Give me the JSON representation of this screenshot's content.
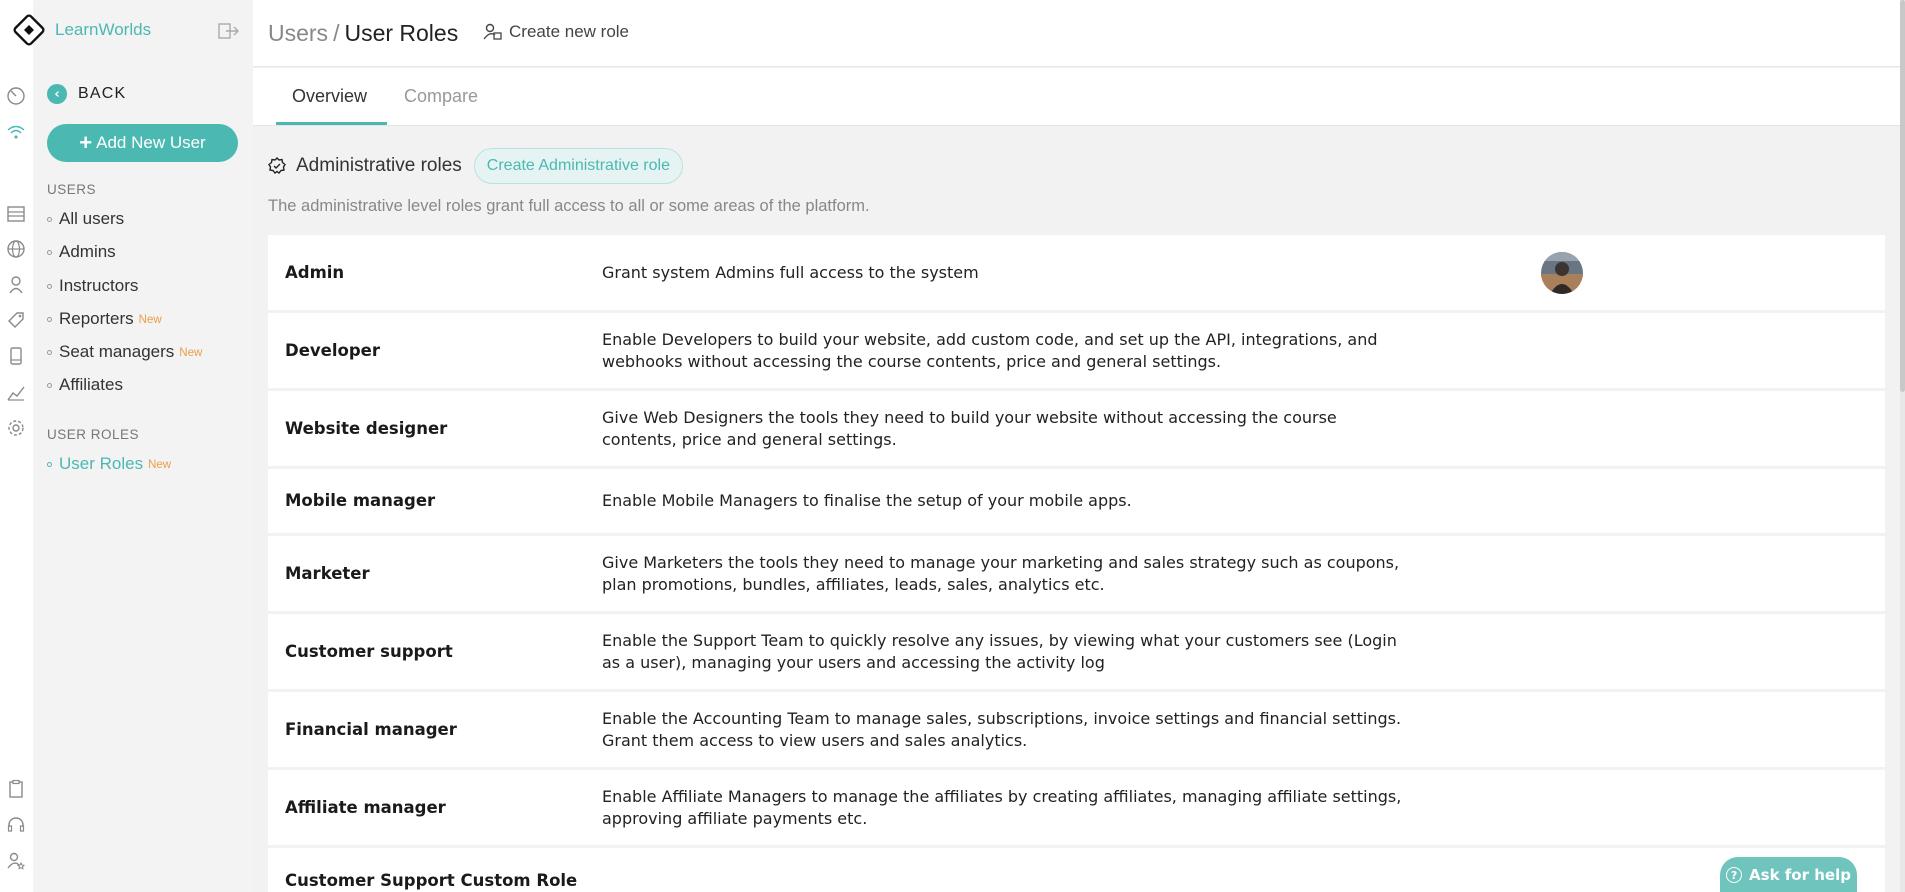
{
  "brand": {
    "name": "LearnWorlds"
  },
  "sidebar": {
    "back_label": "BACK",
    "add_user_label": "Add New User",
    "users_heading": "USERS",
    "user_items": [
      {
        "label": "All users",
        "badge": ""
      },
      {
        "label": "Admins",
        "badge": ""
      },
      {
        "label": "Instructors",
        "badge": ""
      },
      {
        "label": "Reporters",
        "badge": "New"
      },
      {
        "label": "Seat managers",
        "badge": "New"
      },
      {
        "label": "Affiliates",
        "badge": ""
      }
    ],
    "roles_heading": "USER ROLES",
    "role_items": [
      {
        "label": "User Roles",
        "badge": "New"
      }
    ]
  },
  "header": {
    "crumb_parent": "Users",
    "crumb_sep": "/",
    "crumb_current": "User Roles",
    "create_role_label": "Create new role"
  },
  "tabs": [
    {
      "label": "Overview",
      "active": true
    },
    {
      "label": "Compare",
      "active": false
    }
  ],
  "section": {
    "title": "Administrative roles",
    "create_button": "Create Administrative role",
    "description": "The administrative level roles grant full access to all or some areas of the platform."
  },
  "roles": [
    {
      "name": "Admin",
      "description": "Grant system Admins full access to the system",
      "has_avatar": true
    },
    {
      "name": "Developer",
      "description": "Enable Developers to build your website, add custom code, and set up the API, integrations, and webhooks without accessing the course contents, price and general settings."
    },
    {
      "name": "Website designer",
      "description": "Give Web Designers the tools they need to build your website without accessing the course contents, price and general settings."
    },
    {
      "name": "Mobile manager",
      "description": "Enable Mobile Managers to finalise the setup of your mobile apps."
    },
    {
      "name": "Marketer",
      "description": "Give Marketers the tools they need to manage your marketing and sales strategy such as coupons, plan promotions, bundles, affiliates, leads, sales, analytics etc."
    },
    {
      "name": "Customer support",
      "description": "Enable the Support Team to quickly resolve any issues, by viewing what your customers see (Login as a user), managing your users and accessing the activity log"
    },
    {
      "name": "Financial manager",
      "description": "Enable the Accounting Team to manage sales, subscriptions, invoice settings and financial settings. Grant them access to view users and sales analytics."
    },
    {
      "name": "Affiliate manager",
      "description": "Enable Affiliate Managers to manage the affiliates by creating affiliates, managing affiliate settings, approving affiliate payments etc."
    },
    {
      "name": "Customer Support Custom Role",
      "description": ""
    }
  ],
  "help": {
    "label": "Ask for help"
  },
  "colors": {
    "accent": "#4cb8b2",
    "new_badge": "#e8a046"
  },
  "icons": {
    "rail_top": [
      "dashboard-icon",
      "wifi-icon"
    ],
    "rail_mid": [
      "list-icon",
      "globe-icon",
      "user-icon",
      "tag-icon",
      "mobile-icon",
      "chart-icon",
      "gear-icon"
    ],
    "rail_bottom": [
      "clipboard-icon",
      "headset-icon",
      "user-star-icon"
    ]
  }
}
